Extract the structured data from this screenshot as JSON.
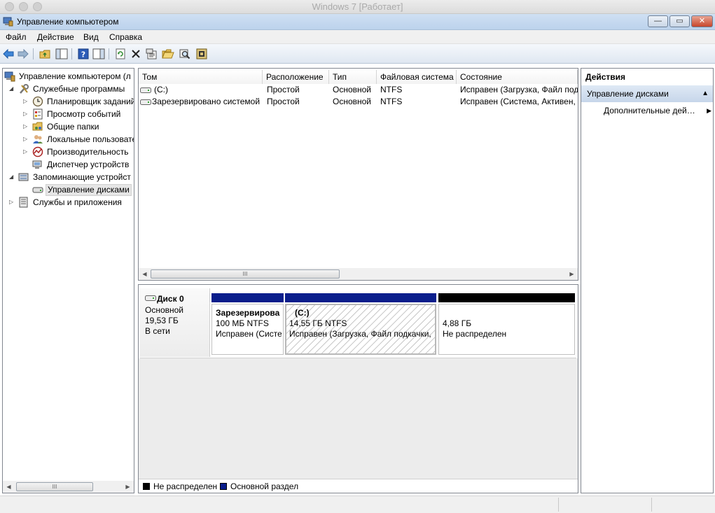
{
  "host": {
    "title": "Windows 7 [Работает]"
  },
  "window": {
    "title": "Управление компьютером",
    "minimize": "—",
    "maximize": "▭",
    "close": "✕"
  },
  "menu": [
    "Файл",
    "Действие",
    "Вид",
    "Справка"
  ],
  "toolbar": [
    "back-arrow-icon",
    "forward-arrow-icon",
    "up-folder-icon",
    "show-hide-tree-icon",
    "help-icon",
    "action-pane-icon",
    "refresh-icon",
    "delete-icon",
    "properties-icon",
    "open-icon",
    "search-icon",
    "settings-icon"
  ],
  "tree": [
    {
      "label": "Управление компьютером (л",
      "icon": "computer-management-icon",
      "expander": "",
      "level": 0
    },
    {
      "label": "Служебные программы",
      "icon": "tools-icon",
      "expander": "◢",
      "level": 1
    },
    {
      "label": "Планировщик заданий",
      "icon": "clock-icon",
      "expander": "▷",
      "level": 2
    },
    {
      "label": "Просмотр событий",
      "icon": "event-viewer-icon",
      "expander": "▷",
      "level": 2
    },
    {
      "label": "Общие папки",
      "icon": "shared-folder-icon",
      "expander": "▷",
      "level": 2
    },
    {
      "label": "Локальные пользовате",
      "icon": "users-icon",
      "expander": "▷",
      "level": 2
    },
    {
      "label": "Производительность",
      "icon": "performance-icon",
      "expander": "▷",
      "level": 2
    },
    {
      "label": "Диспетчер устройств",
      "icon": "device-manager-icon",
      "expander": "",
      "level": 2
    },
    {
      "label": "Запоминающие устройст",
      "icon": "storage-icon",
      "expander": "◢",
      "level": 1
    },
    {
      "label": "Управление дисками",
      "icon": "disk-management-icon",
      "expander": "",
      "level": 2,
      "selected": true
    },
    {
      "label": "Службы и приложения",
      "icon": "services-icon",
      "expander": "▷",
      "level": 1
    }
  ],
  "volumes": {
    "columns": [
      "Том",
      "Расположение",
      "Тип",
      "Файловая система",
      "Состояние"
    ],
    "rows": [
      [
        "(C:)",
        "Простой",
        "Основной",
        "NTFS",
        "Исправен (Загрузка, Файл под"
      ],
      [
        "Зарезервировано системой",
        "Простой",
        "Основной",
        "NTFS",
        "Исправен (Система, Активен, "
      ]
    ]
  },
  "disk": {
    "name": "Диск 0",
    "type": "Основной",
    "size": "19,53 ГБ",
    "status": "В сети",
    "partitions": [
      {
        "name": "Зарезервирова",
        "size": "100 МБ NTFS",
        "status": "Исправен (Систе",
        "color": "#0a1e8c"
      },
      {
        "name": "(C:)",
        "size": "14,55 ГБ NTFS",
        "status": "Исправен (Загрузка, Файл подкачки,",
        "color": "#0a1e8c"
      },
      {
        "name": "",
        "size": "4,88 ГБ",
        "status": "Не распределен",
        "color": "#000000"
      }
    ]
  },
  "legend": [
    {
      "label": "Не распределен",
      "color": "#000000"
    },
    {
      "label": "Основной раздел",
      "color": "#0a1e8c"
    }
  ],
  "actions": {
    "header": "Действия",
    "group": "Управление дисками",
    "item": "Дополнительные дей…"
  },
  "scroll": {
    "thumb": "III"
  }
}
